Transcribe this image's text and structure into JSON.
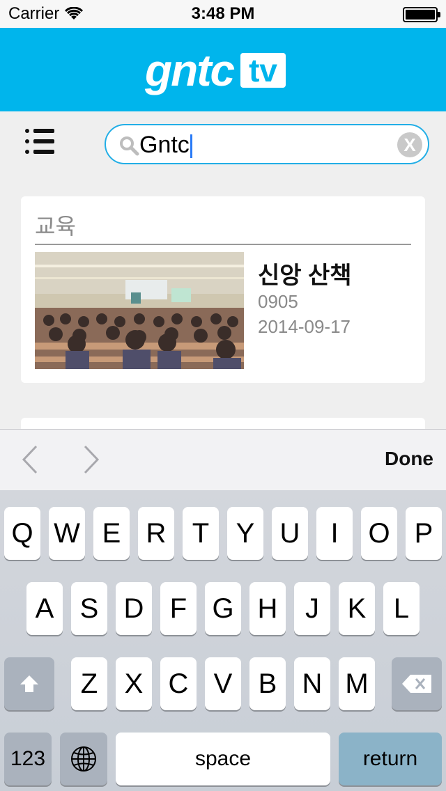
{
  "status_bar": {
    "carrier": "Carrier",
    "time": "3:48 PM"
  },
  "header": {
    "logo_text": "gntc",
    "logo_badge": "tv"
  },
  "search": {
    "value": "Gntc",
    "clear_label": "X"
  },
  "results": {
    "section_title": "교육",
    "items": [
      {
        "title": "신앙 산책",
        "code": "0905",
        "date": "2014-09-17"
      }
    ]
  },
  "accessory": {
    "done_label": "Done"
  },
  "keyboard": {
    "row1": [
      "Q",
      "W",
      "E",
      "R",
      "T",
      "Y",
      "U",
      "I",
      "O",
      "P"
    ],
    "row2": [
      "A",
      "S",
      "D",
      "F",
      "G",
      "H",
      "J",
      "K",
      "L"
    ],
    "row3": [
      "Z",
      "X",
      "C",
      "V",
      "B",
      "N",
      "M"
    ],
    "numbers_label": "123",
    "space_label": "space",
    "return_label": "return"
  },
  "colors": {
    "header_bg": "#00b5ec",
    "search_border": "#22aee6",
    "caret": "#2a7bf6"
  }
}
